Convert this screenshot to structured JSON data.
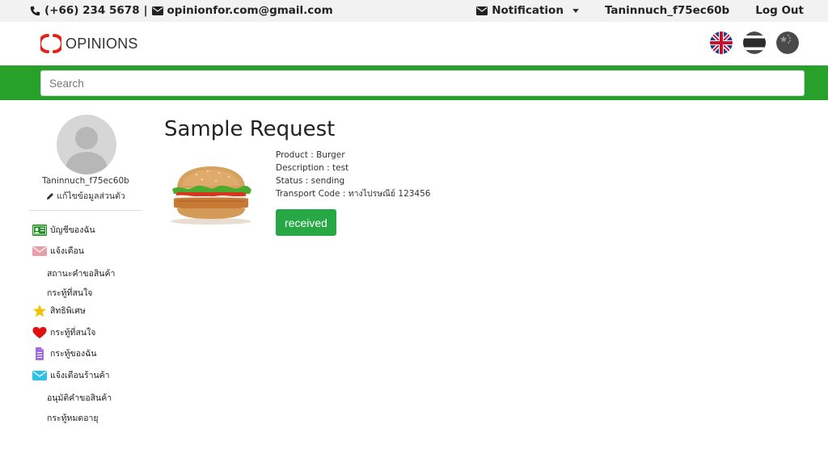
{
  "topbar": {
    "phone": "(+66) 234 5678",
    "separator": "|",
    "email": "opinionfor.com@gmail.com",
    "notification_label": "Notification",
    "username": "Taninnuch_f75ec60b",
    "logout_label": "Log Out"
  },
  "header": {
    "logo_text": "OPINIONS",
    "languages": [
      "english",
      "thai",
      "chinese"
    ]
  },
  "search": {
    "placeholder": "Search"
  },
  "sidebar": {
    "username": "Taninnuch_f75ec60b",
    "edit_profile": "แก้ไขข้อมูลส่วนตัว",
    "menu": [
      {
        "label": "บัญชีของฉัน",
        "icon": "id-card-icon",
        "color": "#1e8c22"
      },
      {
        "label": "แจ้งเตือน",
        "icon": "mail-icon",
        "color": "#e8a0a8"
      },
      {
        "label": "สถานะคำขอสินค้า",
        "sub": true
      },
      {
        "label": "กระทู้ที่สนใจ",
        "sub": true
      },
      {
        "label": "สิทธิพิเศษ",
        "icon": "star-icon",
        "color": "#f5c000"
      },
      {
        "label": "กระทู้ที่สนใจ",
        "icon": "heart-icon",
        "color": "#e01010"
      },
      {
        "label": "กระทู้ของฉัน",
        "icon": "document-icon",
        "color": "#a070e0"
      },
      {
        "label": "แจ้งเตือนร้านค้า",
        "icon": "mail-icon",
        "color": "#2ec0e8"
      },
      {
        "label": "อนุมัติคำขอสินค้า",
        "sub": true
      },
      {
        "label": "กระทู้หมดอายุ",
        "sub": true
      }
    ]
  },
  "main": {
    "title": "Sample Request",
    "details": {
      "product": "Product : Burger",
      "description": "Description : test",
      "status": "Status : sending",
      "transport": "Transport Code : ทางไปรษณีย์ 123456"
    },
    "button_label": "received"
  },
  "colors": {
    "green": "#27a12a",
    "button": "#28a745",
    "logo_red": "#e2231a"
  }
}
